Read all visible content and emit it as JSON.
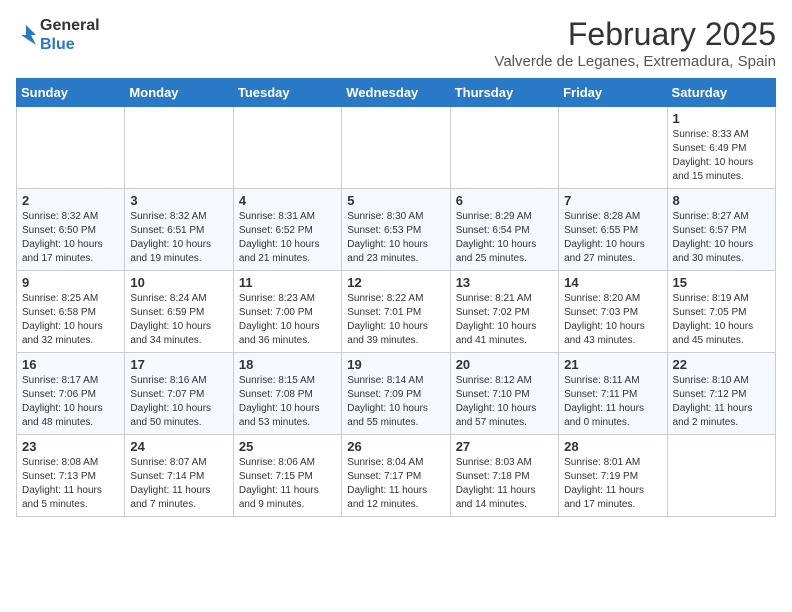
{
  "header": {
    "logo_line1": "General",
    "logo_line2": "Blue",
    "month_title": "February 2025",
    "location": "Valverde de Leganes, Extremadura, Spain"
  },
  "days_of_week": [
    "Sunday",
    "Monday",
    "Tuesday",
    "Wednesday",
    "Thursday",
    "Friday",
    "Saturday"
  ],
  "weeks": [
    [
      {
        "day": "",
        "info": ""
      },
      {
        "day": "",
        "info": ""
      },
      {
        "day": "",
        "info": ""
      },
      {
        "day": "",
        "info": ""
      },
      {
        "day": "",
        "info": ""
      },
      {
        "day": "",
        "info": ""
      },
      {
        "day": "1",
        "info": "Sunrise: 8:33 AM\nSunset: 6:49 PM\nDaylight: 10 hours\nand 15 minutes."
      }
    ],
    [
      {
        "day": "2",
        "info": "Sunrise: 8:32 AM\nSunset: 6:50 PM\nDaylight: 10 hours\nand 17 minutes."
      },
      {
        "day": "3",
        "info": "Sunrise: 8:32 AM\nSunset: 6:51 PM\nDaylight: 10 hours\nand 19 minutes."
      },
      {
        "day": "4",
        "info": "Sunrise: 8:31 AM\nSunset: 6:52 PM\nDaylight: 10 hours\nand 21 minutes."
      },
      {
        "day": "5",
        "info": "Sunrise: 8:30 AM\nSunset: 6:53 PM\nDaylight: 10 hours\nand 23 minutes."
      },
      {
        "day": "6",
        "info": "Sunrise: 8:29 AM\nSunset: 6:54 PM\nDaylight: 10 hours\nand 25 minutes."
      },
      {
        "day": "7",
        "info": "Sunrise: 8:28 AM\nSunset: 6:55 PM\nDaylight: 10 hours\nand 27 minutes."
      },
      {
        "day": "8",
        "info": "Sunrise: 8:27 AM\nSunset: 6:57 PM\nDaylight: 10 hours\nand 30 minutes."
      }
    ],
    [
      {
        "day": "9",
        "info": "Sunrise: 8:25 AM\nSunset: 6:58 PM\nDaylight: 10 hours\nand 32 minutes."
      },
      {
        "day": "10",
        "info": "Sunrise: 8:24 AM\nSunset: 6:59 PM\nDaylight: 10 hours\nand 34 minutes."
      },
      {
        "day": "11",
        "info": "Sunrise: 8:23 AM\nSunset: 7:00 PM\nDaylight: 10 hours\nand 36 minutes."
      },
      {
        "day": "12",
        "info": "Sunrise: 8:22 AM\nSunset: 7:01 PM\nDaylight: 10 hours\nand 39 minutes."
      },
      {
        "day": "13",
        "info": "Sunrise: 8:21 AM\nSunset: 7:02 PM\nDaylight: 10 hours\nand 41 minutes."
      },
      {
        "day": "14",
        "info": "Sunrise: 8:20 AM\nSunset: 7:03 PM\nDaylight: 10 hours\nand 43 minutes."
      },
      {
        "day": "15",
        "info": "Sunrise: 8:19 AM\nSunset: 7:05 PM\nDaylight: 10 hours\nand 45 minutes."
      }
    ],
    [
      {
        "day": "16",
        "info": "Sunrise: 8:17 AM\nSunset: 7:06 PM\nDaylight: 10 hours\nand 48 minutes."
      },
      {
        "day": "17",
        "info": "Sunrise: 8:16 AM\nSunset: 7:07 PM\nDaylight: 10 hours\nand 50 minutes."
      },
      {
        "day": "18",
        "info": "Sunrise: 8:15 AM\nSunset: 7:08 PM\nDaylight: 10 hours\nand 53 minutes."
      },
      {
        "day": "19",
        "info": "Sunrise: 8:14 AM\nSunset: 7:09 PM\nDaylight: 10 hours\nand 55 minutes."
      },
      {
        "day": "20",
        "info": "Sunrise: 8:12 AM\nSunset: 7:10 PM\nDaylight: 10 hours\nand 57 minutes."
      },
      {
        "day": "21",
        "info": "Sunrise: 8:11 AM\nSunset: 7:11 PM\nDaylight: 11 hours\nand 0 minutes."
      },
      {
        "day": "22",
        "info": "Sunrise: 8:10 AM\nSunset: 7:12 PM\nDaylight: 11 hours\nand 2 minutes."
      }
    ],
    [
      {
        "day": "23",
        "info": "Sunrise: 8:08 AM\nSunset: 7:13 PM\nDaylight: 11 hours\nand 5 minutes."
      },
      {
        "day": "24",
        "info": "Sunrise: 8:07 AM\nSunset: 7:14 PM\nDaylight: 11 hours\nand 7 minutes."
      },
      {
        "day": "25",
        "info": "Sunrise: 8:06 AM\nSunset: 7:15 PM\nDaylight: 11 hours\nand 9 minutes."
      },
      {
        "day": "26",
        "info": "Sunrise: 8:04 AM\nSunset: 7:17 PM\nDaylight: 11 hours\nand 12 minutes."
      },
      {
        "day": "27",
        "info": "Sunrise: 8:03 AM\nSunset: 7:18 PM\nDaylight: 11 hours\nand 14 minutes."
      },
      {
        "day": "28",
        "info": "Sunrise: 8:01 AM\nSunset: 7:19 PM\nDaylight: 11 hours\nand 17 minutes."
      },
      {
        "day": "",
        "info": ""
      }
    ]
  ]
}
